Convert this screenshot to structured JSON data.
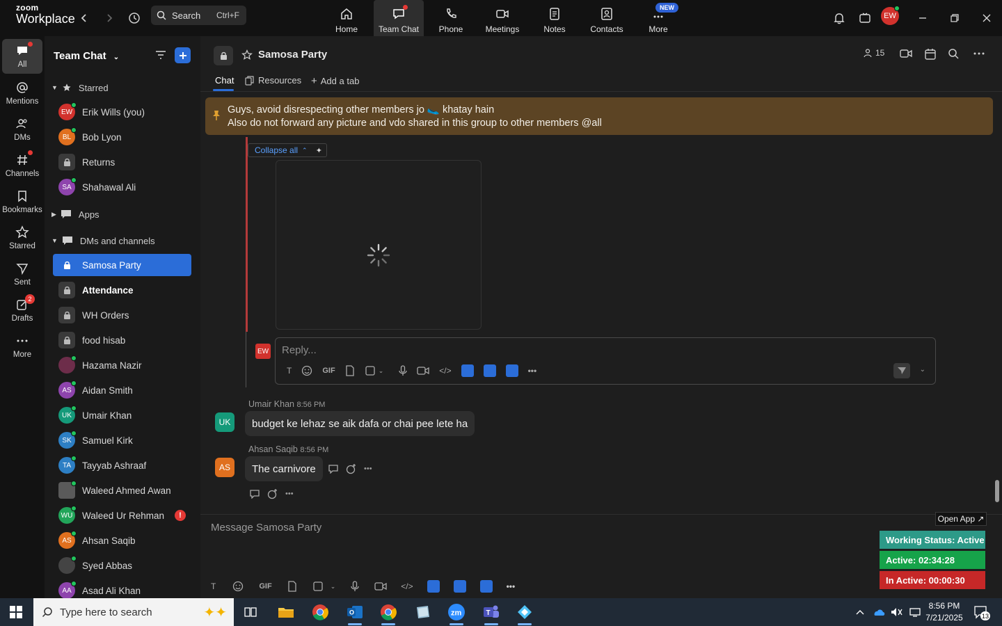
{
  "titlebar": {
    "logo_line1": "zoom",
    "logo_line2": "Workplace",
    "search_label": "Search",
    "search_shortcut": "Ctrl+F",
    "nav": [
      {
        "label": "Home"
      },
      {
        "label": "Team Chat"
      },
      {
        "label": "Phone"
      },
      {
        "label": "Meetings"
      },
      {
        "label": "Notes"
      },
      {
        "label": "Contacts"
      },
      {
        "label": "More"
      }
    ],
    "new_badge": "NEW",
    "user_initials": "EW"
  },
  "rail": {
    "items": [
      {
        "label": "All"
      },
      {
        "label": "Mentions"
      },
      {
        "label": "DMs"
      },
      {
        "label": "Channels"
      },
      {
        "label": "Bookmarks"
      },
      {
        "label": "Starred"
      },
      {
        "label": "Sent"
      },
      {
        "label": "Drafts",
        "badge": "2"
      },
      {
        "label": "More"
      }
    ]
  },
  "sidebar": {
    "title": "Team Chat",
    "sections": {
      "starred": "Starred",
      "apps": "Apps",
      "dms": "DMs and channels"
    },
    "starred_items": [
      {
        "label": "Erik Wills (you)",
        "initials": "EW",
        "color": "#d2322d"
      },
      {
        "label": "Bob Lyon",
        "initials": "BL",
        "color": "#e0701f"
      },
      {
        "label": "Returns"
      },
      {
        "label": "Shahawal Ali",
        "initials": "SA",
        "color": "#8e44ad"
      }
    ],
    "dm_items": [
      {
        "label": "Samosa Party"
      },
      {
        "label": "Attendance"
      },
      {
        "label": "WH Orders"
      },
      {
        "label": "food hisab"
      },
      {
        "label": "Hazama Nazir",
        "initials": "",
        "color": "#6d2d4a"
      },
      {
        "label": "Aidan Smith",
        "initials": "AS",
        "color": "#8e44ad"
      },
      {
        "label": "Umair Khan",
        "initials": "UK",
        "color": "#159a7a"
      },
      {
        "label": "Samuel Kirk",
        "initials": "SK",
        "color": "#2d7fc4"
      },
      {
        "label": "Tayyab Ashraaf",
        "initials": "TA",
        "color": "#2d7fc4"
      },
      {
        "label": "Waleed Ahmed Awan",
        "initials": "",
        "color": "#5a5a5a"
      },
      {
        "label": "Waleed Ur Rehman",
        "initials": "WU",
        "color": "#22a55a",
        "alert": "!"
      },
      {
        "label": "Ahsan Saqib",
        "initials": "AS",
        "color": "#e0701f"
      },
      {
        "label": "Syed Abbas",
        "initials": "",
        "color": "#444"
      },
      {
        "label": "Asad Ali Khan",
        "initials": "AA",
        "color": "#8e44ad"
      }
    ]
  },
  "channel": {
    "name": "Samosa Party",
    "member_count": "15",
    "tabs": [
      "Chat",
      "Resources",
      "Add a tab"
    ],
    "pinned_line1": "Guys, avoid disrespecting other members jo 🥿 khatay hain",
    "pinned_line2": "Also do not forward any picture and vdo shared in this group to other members @all",
    "collapse_label": "Collapse all",
    "reply_placeholder": "Reply...",
    "reply_user_initials": "EW",
    "messages": [
      {
        "author": "Umair Khan",
        "time": "8:56 PM",
        "initials": "UK",
        "color": "#159a7a",
        "text": "budget ke lehaz se aik dafa or chai pee lete ha"
      },
      {
        "author": "Ahsan Saqib",
        "time": "8:56 PM",
        "initials": "AS",
        "color": "#e0701f",
        "text": "The carnivore"
      }
    ],
    "compose_placeholder": "Message Samosa Party",
    "gif_label": "GIF"
  },
  "widget": {
    "open_app": "Open App ↗",
    "working_status": "Working Status: Active",
    "active": "Active: 02:34:28",
    "inactive": "In Active: 00:00:30",
    "colors": {
      "status": "#2d9a88",
      "active": "#16a34a",
      "inactive": "#c62828"
    }
  },
  "taskbar": {
    "search_placeholder": "Type here to search",
    "time": "8:56 PM",
    "date": "7/21/2025",
    "notification_count": "13"
  }
}
